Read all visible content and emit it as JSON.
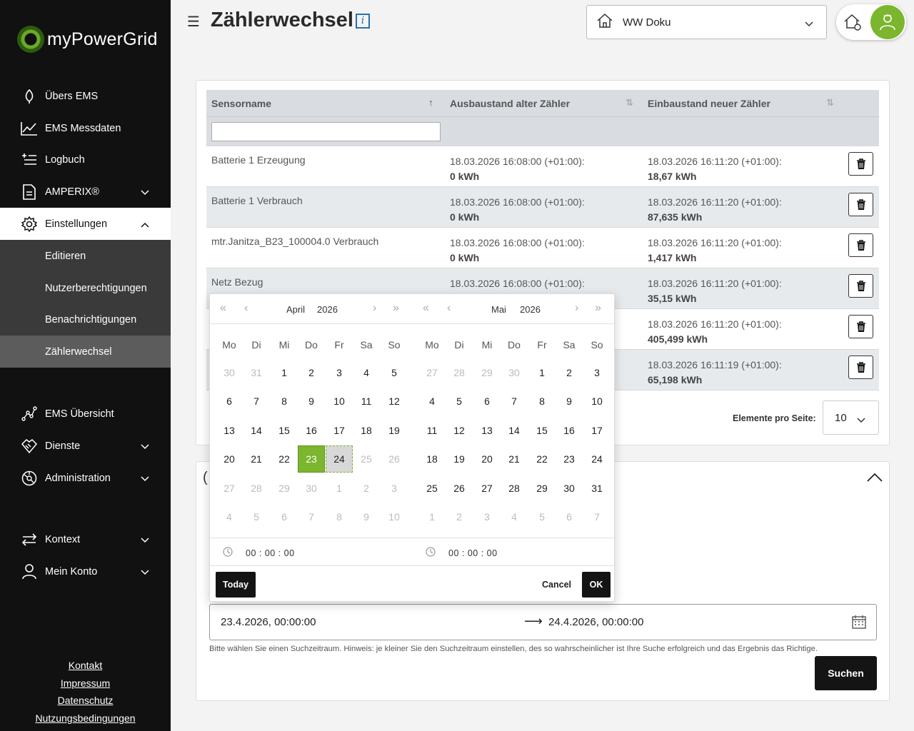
{
  "app": {
    "logo_text": "myPowerGrid"
  },
  "sidebar": {
    "items": [
      {
        "label": "Übers EMS"
      },
      {
        "label": "EMS Messdaten"
      },
      {
        "label": "Logbuch"
      },
      {
        "label": "AMPERIX®"
      },
      {
        "label": "Einstellungen"
      },
      {
        "label": "EMS Übersicht"
      },
      {
        "label": "Dienste"
      },
      {
        "label": "Administration"
      },
      {
        "label": "Kontext"
      },
      {
        "label": "Mein Konto"
      }
    ],
    "subitems": [
      {
        "label": "Editieren"
      },
      {
        "label": "Nutzerberechtigungen"
      },
      {
        "label": "Benachrichtigungen"
      },
      {
        "label": "Zählerwechsel"
      }
    ],
    "footer": [
      "Kontakt",
      "Impressum",
      "Datenschutz",
      "Nutzungsbedingungen"
    ]
  },
  "header": {
    "title": "Zählerwechsel",
    "site": "WW Doku",
    "info_glyph": "i"
  },
  "table": {
    "columns": [
      "Sensorname",
      "Ausbaustand alter Zähler",
      "Einbaustand neuer Zähler"
    ],
    "filter_value": "",
    "rows": [
      {
        "name": "Batterie 1 Erzeugung",
        "old_ts": "18.03.2026 16:08:00 (+01:00):",
        "old_val": "0 kWh",
        "new_ts": "18.03.2026 16:11:20 (+01:00):",
        "new_val": "18,67 kWh"
      },
      {
        "name": "Batterie 1 Verbrauch",
        "old_ts": "18.03.2026 16:08:00 (+01:00):",
        "old_val": "0 kWh",
        "new_ts": "18.03.2026 16:11:20 (+01:00):",
        "new_val": "87,635 kWh"
      },
      {
        "name": "mtr.Janitza_B23_100004.0 Verbrauch",
        "old_ts": "18.03.2026 16:08:00 (+01:00):",
        "old_val": "0 kWh",
        "new_ts": "18.03.2026 16:11:20 (+01:00):",
        "new_val": "1,417 kWh"
      },
      {
        "name": "Netz Bezug",
        "old_ts": "18.03.2026 16:08:00 (+01:00):",
        "old_val": "",
        "new_ts": "18.03.2026 16:11:20 (+01:00):",
        "new_val": "35,15 kWh"
      },
      {
        "name": "",
        "old_ts": "",
        "old_val": "",
        "new_ts": "18.03.2026 16:11:20 (+01:00):",
        "new_val": "405,499 kWh"
      },
      {
        "name": "",
        "old_ts": "",
        "old_val": "",
        "new_ts": "18.03.2026 16:11:19 (+01:00):",
        "new_val": "65,198 kWh"
      }
    ],
    "per_page_label": "Elemente pro Seite:",
    "per_page_value": "10"
  },
  "search": {
    "range_start": "23.4.2026, 00:00:00",
    "range_end": "24.4.2026, 00:00:00",
    "hint": "Bitte wählen Sie einen Suchzeitraum. Hinweis: je kleiner Sie den Suchzeitraum einstellen, des so wahrscheinlicher ist Ihre Suche erfolgreich und das Ergebnis das Richtige.",
    "button": "Suchen"
  },
  "datepicker": {
    "weekdays": [
      "Mo",
      "Di",
      "Mi",
      "Do",
      "Fr",
      "Sa",
      "So"
    ],
    "left": {
      "month": "April",
      "year": "2026",
      "days": [
        30,
        31,
        1,
        2,
        3,
        4,
        5,
        6,
        7,
        8,
        9,
        10,
        11,
        12,
        13,
        14,
        15,
        16,
        17,
        18,
        19,
        20,
        21,
        22,
        23,
        24,
        25,
        26,
        27,
        28,
        29,
        30,
        1,
        2,
        3,
        4,
        5,
        6,
        7,
        8,
        9,
        10
      ],
      "first_in": 2,
      "last_in": 31,
      "range_start": 23,
      "range_end": 24,
      "last_enabled": 24,
      "time": "00 : 00 : 00"
    },
    "right": {
      "month": "Mai",
      "year": "2026",
      "days": [
        27,
        28,
        29,
        30,
        1,
        2,
        3,
        4,
        5,
        6,
        7,
        8,
        9,
        10,
        11,
        12,
        13,
        14,
        15,
        16,
        17,
        18,
        19,
        20,
        21,
        22,
        23,
        24,
        25,
        26,
        27,
        28,
        29,
        30,
        31,
        1,
        2,
        3,
        4,
        5,
        6,
        7
      ],
      "first_in": 4,
      "last_in": 34,
      "range_start": -1,
      "range_end": -1,
      "last_enabled": -1,
      "time": "00 : 00 : 00"
    },
    "today": "Today",
    "cancel": "Cancel",
    "ok": "OK"
  },
  "colors": {
    "accent": "#7cb52e",
    "sidebar_bg": "#111111",
    "submenu_bg": "#3a3a3a"
  }
}
